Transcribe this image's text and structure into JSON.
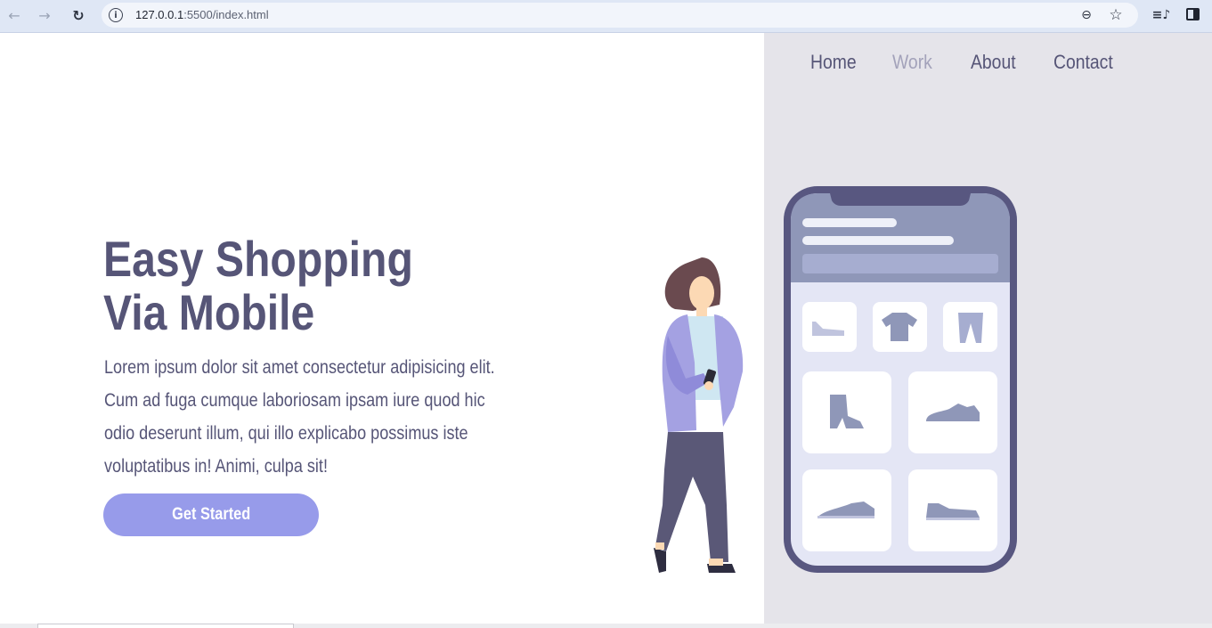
{
  "browser": {
    "url_host": "127.0.0.1",
    "url_path": ":5500/index.html",
    "icons": {
      "back": "arrow-left",
      "forward": "arrow-right",
      "reload": "reload",
      "site_info": "info",
      "zoom": "zoom-out",
      "bookmark": "star",
      "media": "media-controls",
      "side_panel": "side-panel"
    }
  },
  "nav": {
    "items": [
      {
        "label": "Home"
      },
      {
        "label": "Work"
      },
      {
        "label": "About"
      },
      {
        "label": "Contact"
      }
    ]
  },
  "hero": {
    "title_line1": "Easy Shopping",
    "title_line2": "Via Mobile",
    "text": "Lorem ipsum dolor sit amet consectetur adipisicing elit. Cum ad fuga cumque laboriosam ipsam iure quod hic odio deserunt illum, qui illo explicabo possimus iste voluptatibus in! Animi, culpa sit!",
    "cta_label": "Get Started"
  },
  "colors": {
    "text_primary": "#565577",
    "nav_active": "#a3a2ba",
    "accent": "#979bea",
    "panel_bg": "#e5e4ea",
    "phone_frame": "#585780"
  }
}
